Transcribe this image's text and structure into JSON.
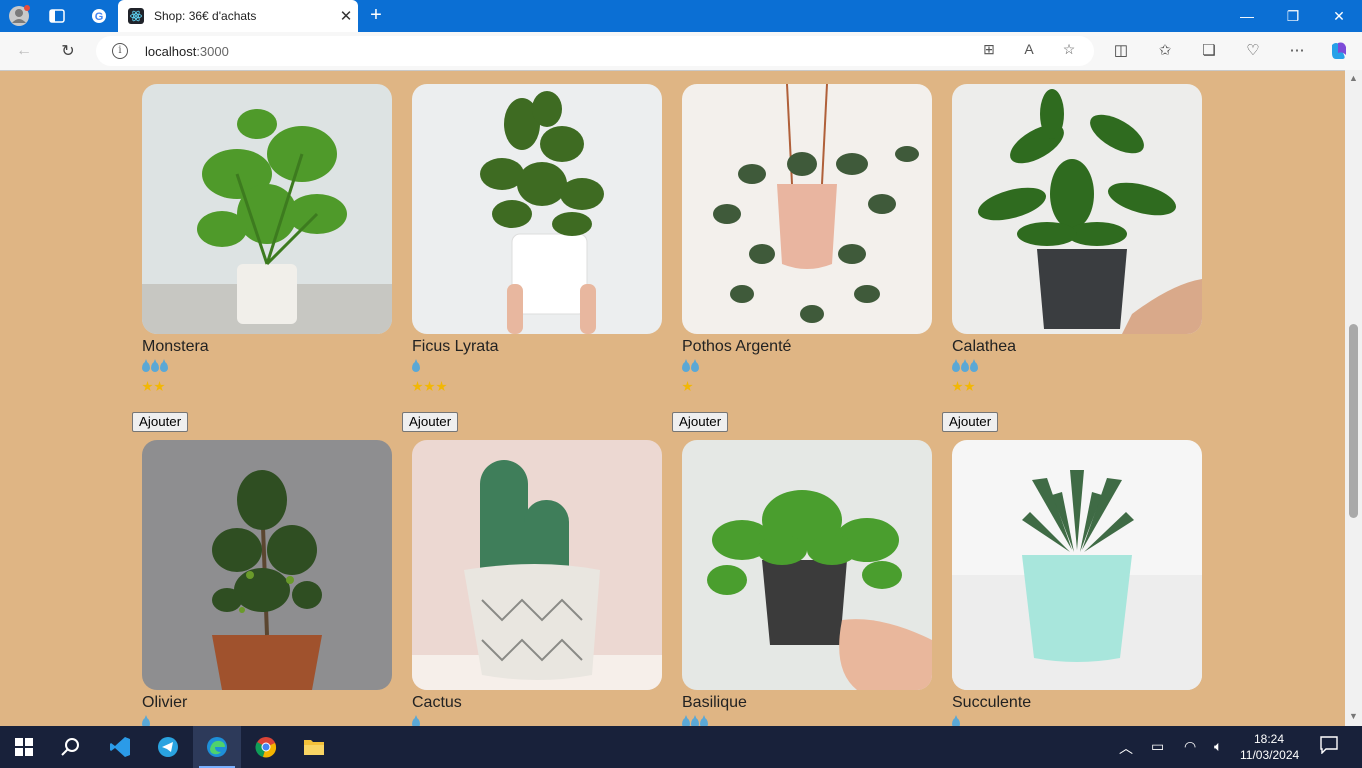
{
  "browser": {
    "tab_title": "Shop: 36€ d'achats",
    "url_host": "localhost",
    "url_port": ":3000"
  },
  "plants": [
    {
      "name": "Monstera",
      "water": 3,
      "light": 2
    },
    {
      "name": "Ficus Lyrata",
      "water": 1,
      "light": 3
    },
    {
      "name": "Pothos Argenté",
      "water": 2,
      "light": 1
    },
    {
      "name": "Calathea",
      "water": 3,
      "light": 2
    },
    {
      "name": "Olivier",
      "water": 1,
      "light": null
    },
    {
      "name": "Cactus",
      "water": 1,
      "light": null
    },
    {
      "name": "Basilique",
      "water": 3,
      "light": null
    },
    {
      "name": "Succulente",
      "water": 1,
      "light": null
    }
  ],
  "add_label": "Ajouter",
  "taskbar": {
    "time": "18:24",
    "date": "11/03/2024"
  },
  "colors": {
    "page_bg": "#dfb584",
    "accent": "#0b6fd4",
    "water": "#5aa8d6",
    "sun": "#f2b705"
  }
}
